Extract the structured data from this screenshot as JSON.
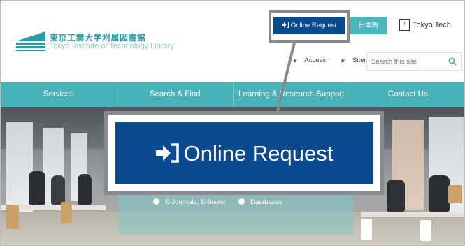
{
  "header": {
    "logo_jp": "東京工業大学附属図書館",
    "logo_en": "Tokyo Institute of Technology Library",
    "online_request": "Online Request",
    "language": "日本語",
    "tokyo_tech": "Tokyo Tech",
    "utility_links": [
      "Access",
      "Sitemap"
    ],
    "search_placeholder": "Search this site"
  },
  "nav": {
    "items": [
      "Services",
      "Search & Find",
      "Learning & Research Support",
      "Contact Us"
    ]
  },
  "hero": {
    "links": [
      "E-Journals, E-Books",
      "Databases"
    ]
  },
  "zoom_callout": {
    "label": "Online Request"
  },
  "colors": {
    "online_button": "#0b4a8f",
    "teal": "#49b2b8",
    "callout_border": "#8a8a8a"
  }
}
